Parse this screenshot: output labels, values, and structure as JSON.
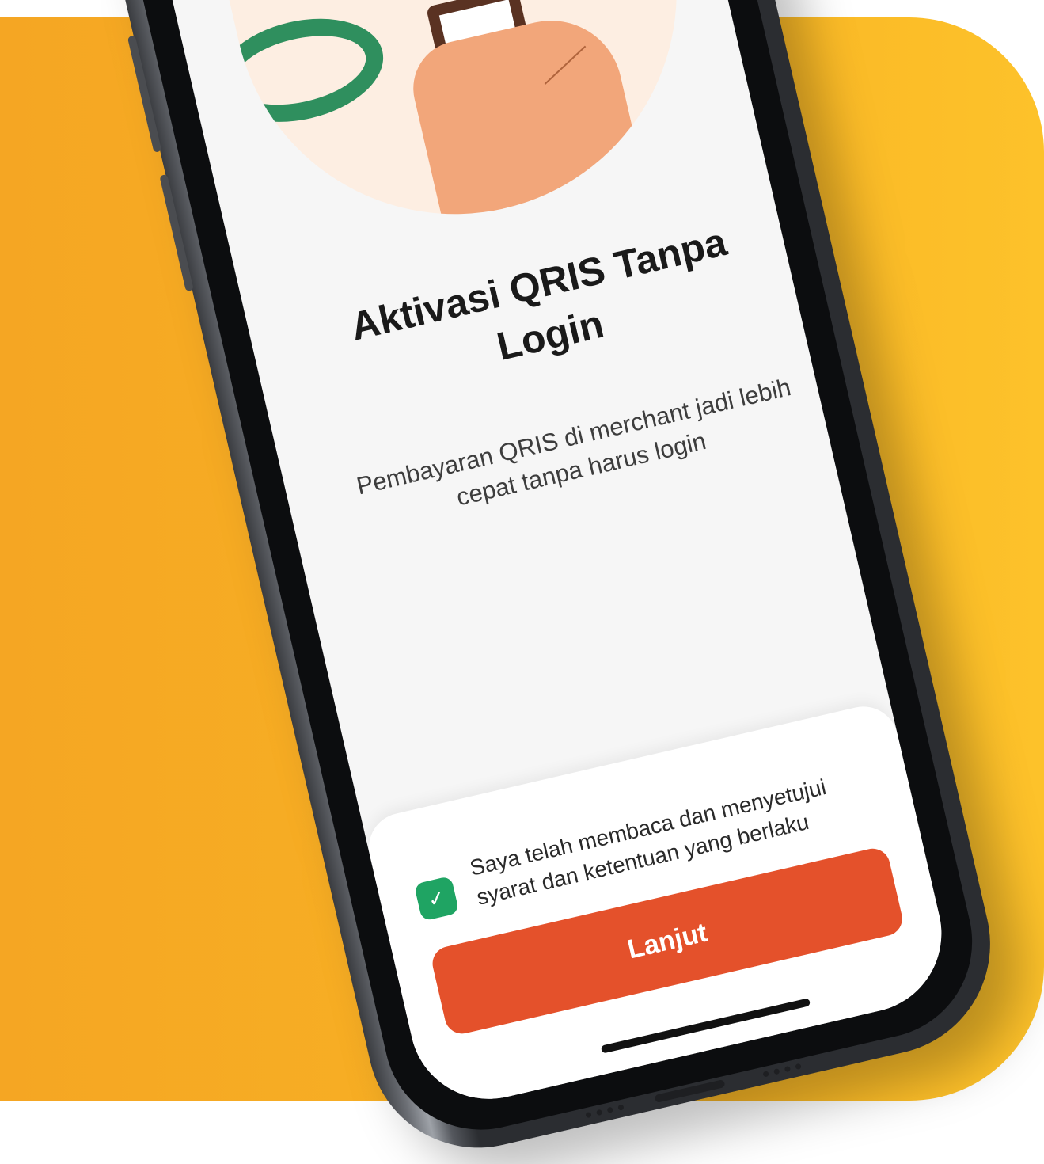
{
  "screen": {
    "title": "Aktivasi QRIS Tanpa Login",
    "subtitle": "Pembayaran QRIS di merchant jadi lebih cepat tanpa harus login"
  },
  "consent": {
    "checked": true,
    "text": "Saya telah membaca dan menyetujui syarat dan ketentuan yang berlaku",
    "check_icon": "check-icon"
  },
  "actions": {
    "continue_label": "Lanjut"
  },
  "colors": {
    "background": "#f7ad24",
    "primary_button": "#e4512b",
    "checkbox": "#1fa463",
    "screen": "#f6f6f6"
  }
}
